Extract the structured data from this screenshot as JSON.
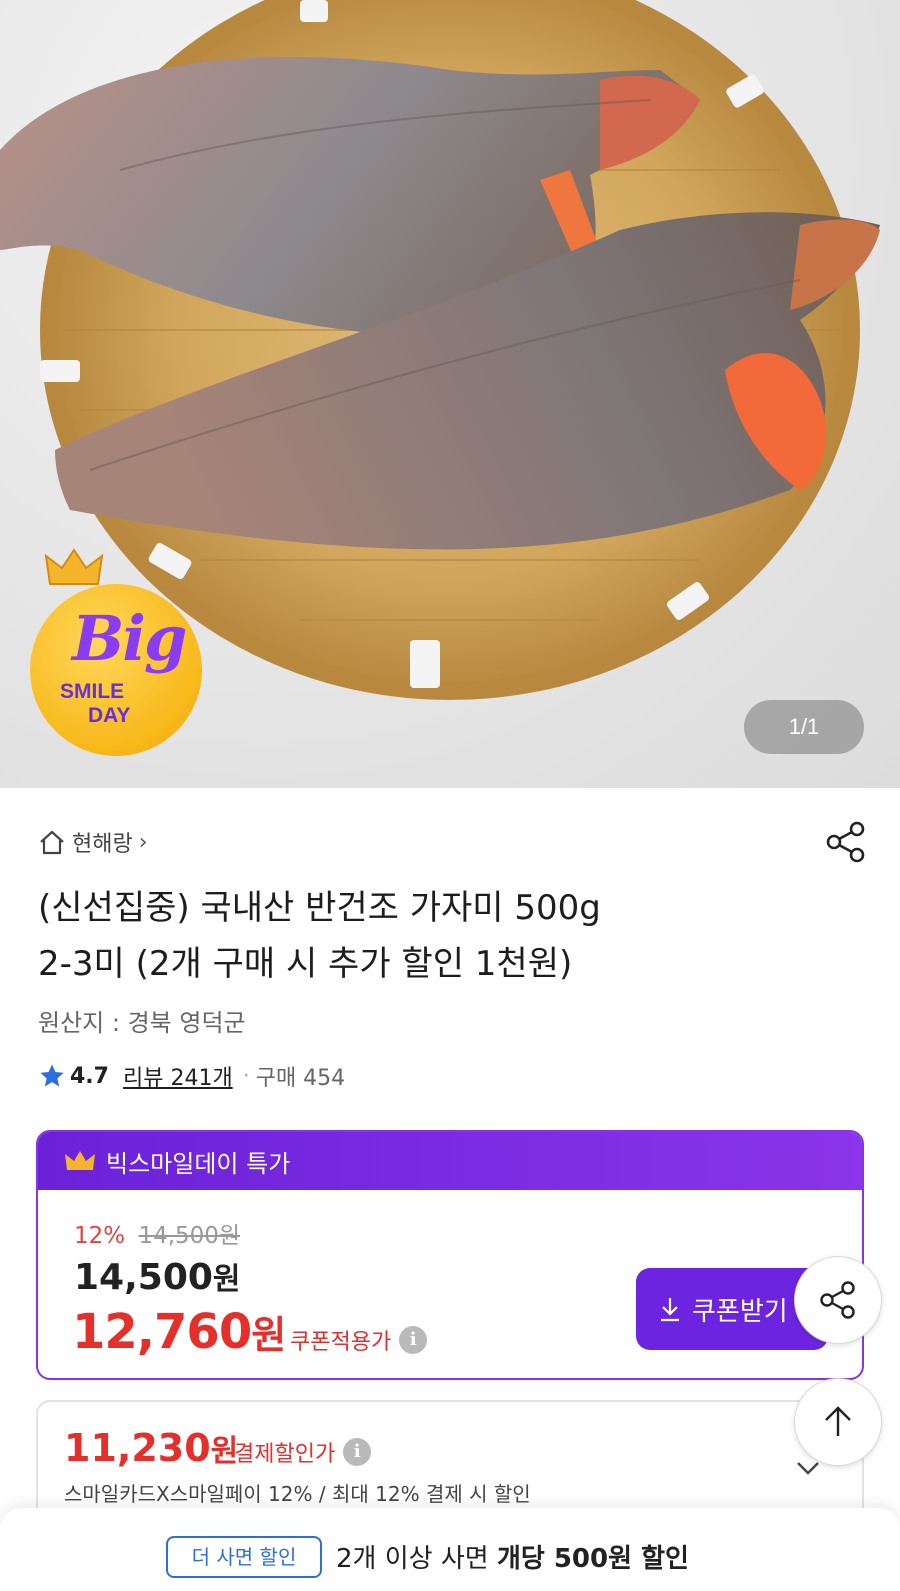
{
  "hero": {
    "badge": {
      "big": "Big",
      "smile": "SMILE",
      "day": "DAY"
    },
    "pager": "1/1"
  },
  "seller": {
    "name": "현해랑",
    "chevron": "›"
  },
  "product": {
    "title_line1": "(신선집중) 국내산 반건조 가자미 500g",
    "title_line2": "2-3미 (2개 구매 시 추가 할인 1천원)",
    "origin": "원산지 : 경북 영덕군",
    "rating": "4.7",
    "review": "리뷰 241개",
    "separator": "·",
    "purchases": "구매 454"
  },
  "deal": {
    "header": "빅스마일데이 특가",
    "discount_pct": "12%",
    "original_price": "14,500원",
    "price_number": "14,500",
    "price_unit": "원",
    "coupon_price_number": "12,760",
    "coupon_price_unit": "원",
    "coupon_label": "쿠폰적용가",
    "coupon_button": "쿠폰받기"
  },
  "payment": {
    "amount_number": "11,230",
    "amount_unit": "원",
    "label": "결제할인가",
    "card_info": "스마일카드X스마일페이 12% / 최대 12% 결제 시 할인"
  },
  "bottom": {
    "tag": "더 사면 할인",
    "text_prefix": "2개 이상 사면 ",
    "text_bold": "개당 500원 할인"
  },
  "colors": {
    "accent_purple": "#6d24e0",
    "price_red": "#e52f2a",
    "link_blue": "#2b6fdc"
  },
  "icons": [
    "home-icon",
    "share-icon",
    "star-icon",
    "crown-icon",
    "info-icon",
    "download-icon",
    "arrow-up-icon",
    "chevron-down-icon"
  ]
}
